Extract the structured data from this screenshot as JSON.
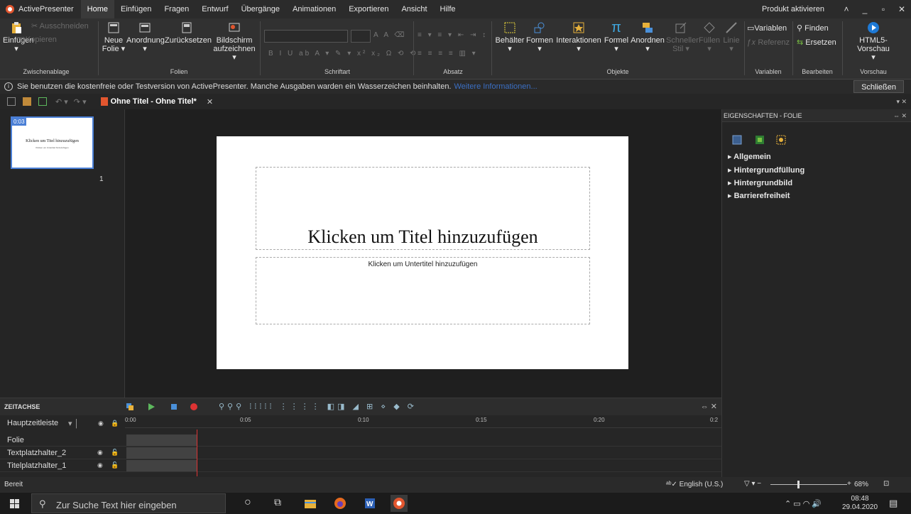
{
  "app": {
    "name": "ActivePresenter",
    "activate": "Produkt aktivieren"
  },
  "menu": {
    "tabs": [
      "Home",
      "Einfügen",
      "Fragen",
      "Entwurf",
      "Übergänge",
      "Animationen",
      "Exportieren",
      "Ansicht",
      "Hilfe"
    ]
  },
  "ribbon": {
    "clipboard": {
      "paste": "Einfügen",
      "cut": "Ausschneiden",
      "copy": "Kopieren",
      "group": "Zwischenablage"
    },
    "slides": {
      "new": "Neue",
      "new2": "Folie ▾",
      "layout": "Anordnung",
      "reset": "Zurücksetzen",
      "record": "Bildschirm",
      "record2": "aufzeichnen ▾",
      "group": "Folien"
    },
    "font": {
      "group": "Schriftart"
    },
    "paragraph": {
      "group": "Absatz"
    },
    "objects": {
      "container": "Behälter",
      "shapes": "Formen",
      "interactions": "Interaktionen",
      "formula": "Formel",
      "arrange": "Anordnen",
      "quickstyle": "Schneller",
      "quickstyle2": "Stil ▾",
      "fill": "Füllen",
      "line": "Linie",
      "group": "Objekte"
    },
    "variables": {
      "variables": "Variablen",
      "reference": "Referenz",
      "group": "Variablen"
    },
    "edit": {
      "find": "Finden",
      "replace": "Ersetzen",
      "group": "Bearbeiten"
    },
    "preview": {
      "html5": "HTML5-Vorschau",
      "group": "Vorschau"
    }
  },
  "info": {
    "text": "Sie benutzen die kostenfreie oder Testversion von ActivePresenter. Manche Ausgaben warden ein Wasserzeichen beinhalten.",
    "link": "Weitere Informationen...",
    "close": "Schließen"
  },
  "doc": {
    "tab": "Ohne Titel - Ohne Titel*"
  },
  "thumb": {
    "time": "0:03",
    "title": "Klicken um Titel hinzuzufügen",
    "subtitle": "Klicken um Untertitel hinzuzufügen",
    "number": "1"
  },
  "slide": {
    "title": "Klicken um Titel hinzuzufügen",
    "subtitle": "Klicken um Untertitel hinzuzufügen"
  },
  "props": {
    "header": "EIGENSCHAFTEN - FOLIE",
    "sections": [
      "Allgemein",
      "Hintergrundfüllung",
      "Hintergrundbild",
      "Barrierefreiheit"
    ]
  },
  "timeline": {
    "header": "ZEITACHSE",
    "track": "Hauptzeitleiste",
    "ticks": [
      "0:00",
      "0:05",
      "0:10",
      "0:15",
      "0:20",
      "0:2"
    ],
    "rows": [
      "Folie",
      "Textplatzhalter_2",
      "Titelplatzhalter_1"
    ]
  },
  "status": {
    "ready": "Bereit",
    "language": "English (U.S.)",
    "zoom": "68%"
  },
  "taskbar": {
    "search": "Zur Suche Text hier eingeben",
    "time": "08:48",
    "date": "29.04.2020"
  }
}
